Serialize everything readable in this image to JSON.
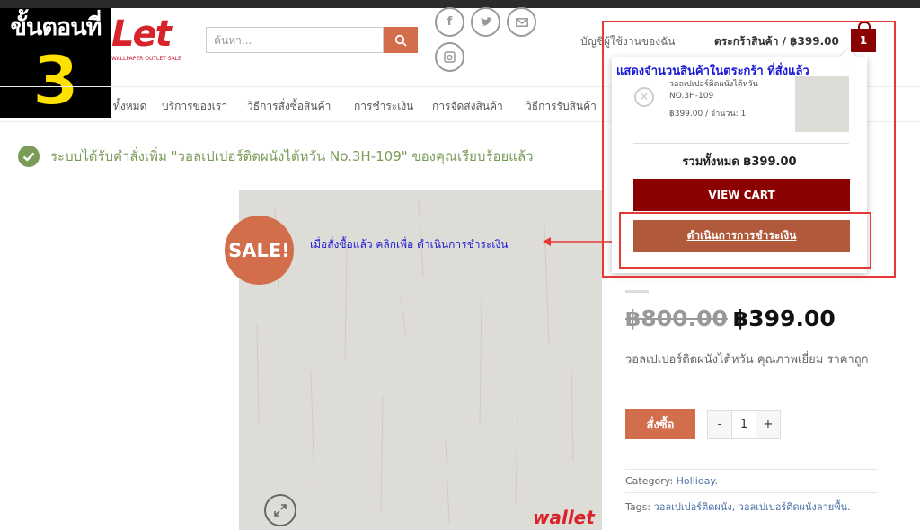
{
  "step_badge": {
    "label": "ขั้นตอนที่",
    "number": "3"
  },
  "logo": {
    "word": "Let",
    "subtitle": "WALLPAPER OUTLET SALE"
  },
  "search": {
    "placeholder": "ค้นหา..."
  },
  "social": [
    "facebook-icon",
    "twitter-icon",
    "email-icon",
    "instagram-icon"
  ],
  "header": {
    "account_label": "บัญชีผู้ใช้งานของฉัน",
    "cart_label": "ตระกร้าสินค้า / ฿399.00",
    "cart_count": "1"
  },
  "nav": {
    "items": [
      "ทั้งหมด",
      "บริการของเรา",
      "วิธีการสั่งซื้อสินค้า",
      "การชำระเงิน",
      "การจัดส่งสินค้า",
      "วิธีการรับสินค้า"
    ]
  },
  "notice": {
    "text": "ระบบได้รับคำสั่งเพิ่ม \"วอลเปเปอร์ติดผนังไต้หวัน No.3H-109\" ของคุณเรียบร้อยแล้ว"
  },
  "product": {
    "sale_label": "SALE!",
    "old_price": "฿800.00",
    "new_price": "฿399.00",
    "short_description": "วอลเปเปอร์ติดผนังไต้หวัน คุณภาพเยี่ยม ราคาถูก",
    "buy_label": "สั่งซื้อ",
    "quantity": "1",
    "minus": "-",
    "plus": "+",
    "category_label": "Category:",
    "category_value": "Holliday.",
    "tags_label": "Tags:",
    "tags_value": "วอลเปเปอร์ติดผนัง, วอลเปเปอร์ติดผนังลายพื้น.",
    "watermark": "wallet"
  },
  "annotations": {
    "checkout_hint": "เมื่อสั่งซื้อแล้ว คลิกเพื่อ ดำเนินการชำระเงิน",
    "cart_hint": "แสดงจำนวนสินค้าในตระกร้า ที่สั่งแล้ว"
  },
  "mini_cart": {
    "item_name": "วอลเปเปอร์ติดผนังไต้หวัน NO.3H-109",
    "item_price_qty": "฿399.00 / จำนวน: 1",
    "total": "รวมทั้งหมด ฿399.00",
    "view_cart_label": "VIEW CART",
    "checkout_label": "ดำเนินการการชำระเงิน"
  },
  "colors": {
    "accent": "#d26e4b",
    "dark_red": "#8b0000",
    "success": "#7a9c59",
    "annotation_red": "#e53935",
    "annotation_blue": "#1a1ad6"
  }
}
